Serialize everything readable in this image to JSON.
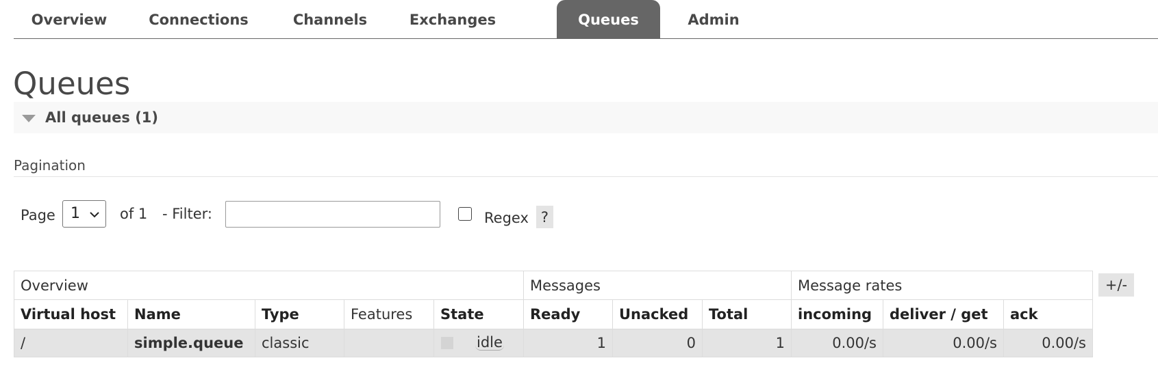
{
  "nav": {
    "tabs": [
      {
        "label": "Overview",
        "active": false
      },
      {
        "label": "Connections",
        "active": false
      },
      {
        "label": "Channels",
        "active": false
      },
      {
        "label": "Exchanges",
        "active": false
      },
      {
        "label": "Queues",
        "active": true
      },
      {
        "label": "Admin",
        "active": false
      }
    ]
  },
  "page": {
    "title": "Queues",
    "section_title": "All queues (1)"
  },
  "pagination": {
    "heading": "Pagination",
    "page_label": "Page",
    "page_value": "1",
    "of_label": "of 1",
    "filter_label": "- Filter:",
    "filter_value": "",
    "regex_label": "Regex",
    "regex_checked": false,
    "help_label": "?"
  },
  "table": {
    "groups": [
      "Overview",
      "Messages",
      "Message rates"
    ],
    "columns": {
      "vhost": "Virtual host",
      "name": "Name",
      "type": "Type",
      "features": "Features",
      "state": "State",
      "ready": "Ready",
      "unacked": "Unacked",
      "total": "Total",
      "incoming": "incoming",
      "deliver_get": "deliver / get",
      "ack": "ack"
    },
    "rows": [
      {
        "vhost": "/",
        "name": "simple.queue",
        "type": "classic",
        "features": "",
        "state": "idle",
        "ready": "1",
        "unacked": "0",
        "total": "1",
        "incoming": "0.00/s",
        "deliver_get": "0.00/s",
        "ack": "0.00/s"
      }
    ],
    "toggle_columns_label": "+/-"
  },
  "colors": {
    "active_tab_bg": "#666666",
    "text": "#484848",
    "row_bg": "#e4e4e4",
    "section_bg": "#f8f8f8"
  }
}
